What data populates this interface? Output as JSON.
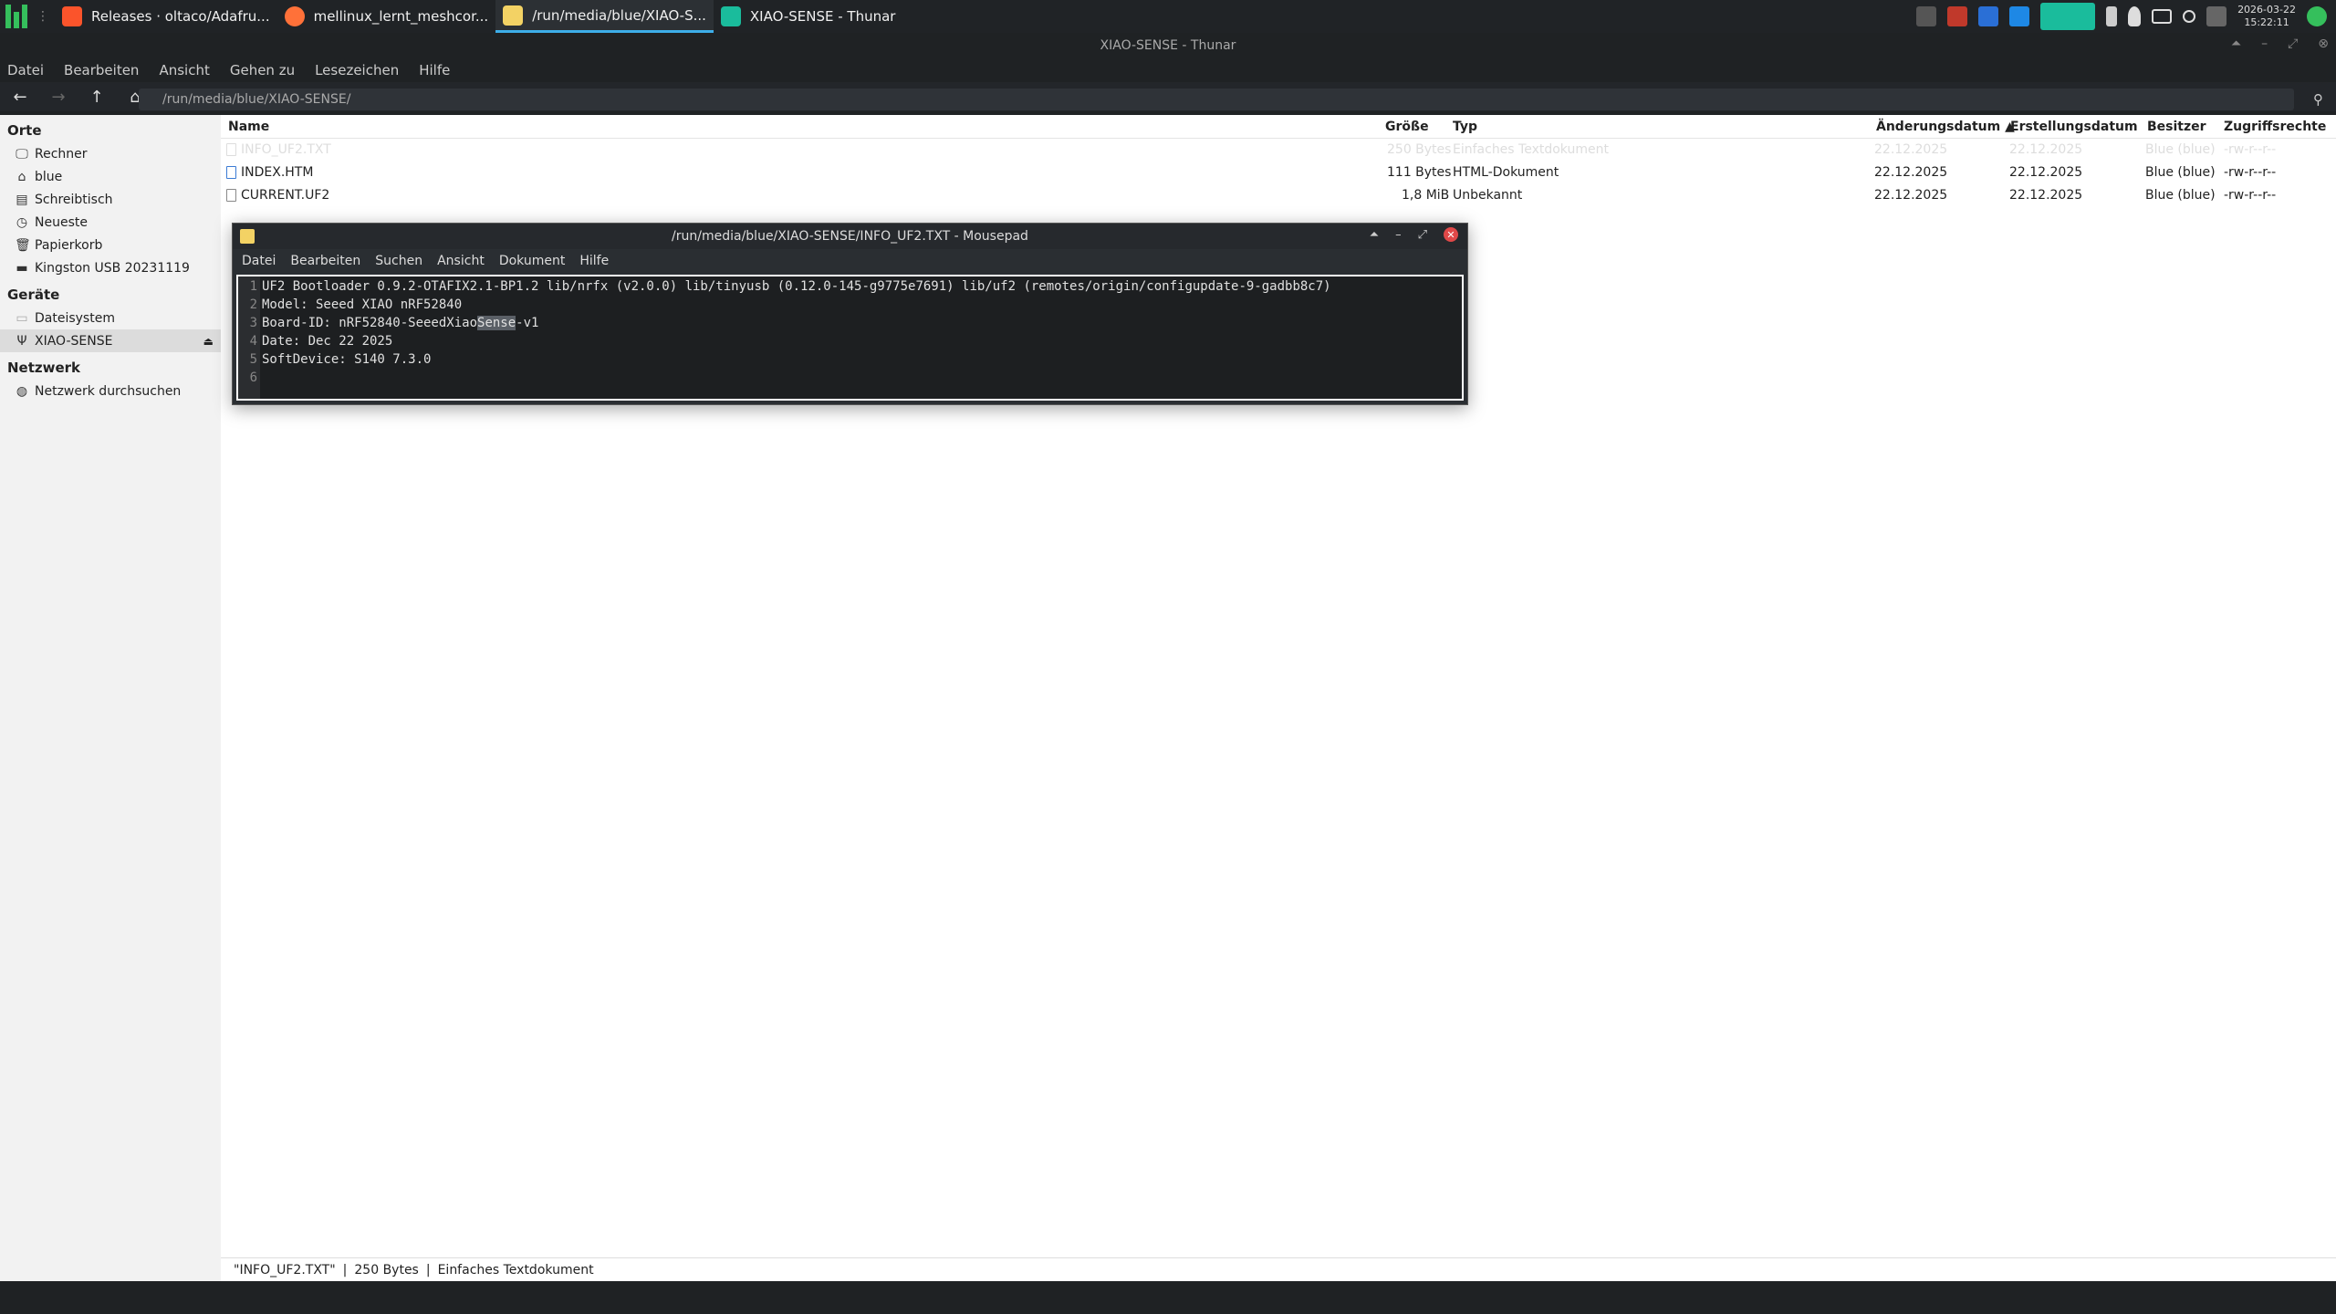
{
  "panel": {
    "tasks": [
      {
        "label": "Releases · oltaco/Adafru...",
        "color": "#fb542b"
      },
      {
        "label": "mellinux_lernt_meshcor...",
        "color": "#ff7139"
      },
      {
        "label": "/run/media/blue/XIAO-S...",
        "color": "#f3d264"
      },
      {
        "label": "XIAO-SENSE - Thunar",
        "color": "#1abc9c"
      }
    ],
    "clock_date": "2026-03-22",
    "clock_time": "15:22:11",
    "tray_icons": [
      "pen-icon",
      "flash-icon",
      "vc-icon",
      "chat-icon",
      "thunar-icon",
      "clipboard-icon",
      "shield-icon",
      "display-icon",
      "link-icon",
      "mute-icon",
      "update-icon"
    ]
  },
  "thunar": {
    "title": "XIAO-SENSE - Thunar",
    "menu": [
      "Datei",
      "Bearbeiten",
      "Ansicht",
      "Gehen zu",
      "Lesezeichen",
      "Hilfe"
    ],
    "path": "/run/media/blue/XIAO-SENSE/"
  },
  "sidebar": {
    "places_title": "Orte",
    "places": [
      "Rechner",
      "blue",
      "Schreibtisch",
      "Neueste",
      "Papierkorb",
      "Kingston USB 20231119"
    ],
    "devices_title": "Geräte",
    "devices": [
      "Dateisystem",
      "XIAO-SENSE"
    ],
    "network_title": "Netzwerk",
    "network": [
      "Netzwerk durchsuchen"
    ]
  },
  "columns": {
    "name": "Name",
    "size": "Größe",
    "type": "Typ",
    "modified": "Änderungsdatum ▲",
    "created": "Erstellungsdatum",
    "owner": "Besitzer",
    "perms": "Zugriffsrechte"
  },
  "files": [
    {
      "name": "INFO_UF2.TXT",
      "size": "250 Bytes",
      "type": "Einfaches Textdokument",
      "modified": "22.12.2025",
      "created": "22.12.2025",
      "owner": "Blue (blue)",
      "perms": "-rw-r--r--"
    },
    {
      "name": "INDEX.HTM",
      "size": "111 Bytes",
      "type": "HTML-Dokument",
      "modified": "22.12.2025",
      "created": "22.12.2025",
      "owner": "Blue (blue)",
      "perms": "-rw-r--r--"
    },
    {
      "name": "CURRENT.UF2",
      "size": "1,8 MiB",
      "type": "Unbekannt",
      "modified": "22.12.2025",
      "created": "22.12.2025",
      "owner": "Blue (blue)",
      "perms": "-rw-r--r--"
    }
  ],
  "status": {
    "name": "\"INFO_UF2.TXT\"",
    "size": "250 Bytes",
    "type": "Einfaches Textdokument"
  },
  "mousepad": {
    "title": "/run/media/blue/XIAO-SENSE/INFO_UF2.TXT - Mousepad",
    "menu": [
      "Datei",
      "Bearbeiten",
      "Suchen",
      "Ansicht",
      "Dokument",
      "Hilfe"
    ],
    "line_numbers": [
      "1",
      "2",
      "3",
      "4",
      "5",
      "6"
    ],
    "lines": [
      "UF2 Bootloader 0.9.2-OTAFIX2.1-BP1.2 lib/nrfx (v2.0.0) lib/tinyusb (0.12.0-145-g9775e7691) lib/uf2 (remotes/origin/configupdate-9-gadbb8c7)",
      "Model: Seeed XIAO nRF52840",
      "",
      "Date: Dec 22 2025",
      "SoftDevice: S140 7.3.0",
      ""
    ],
    "line3_pre": "Board-ID: nRF52840-SeeedXiao",
    "line3_sel": "Sense",
    "line3_post": "-v1"
  }
}
